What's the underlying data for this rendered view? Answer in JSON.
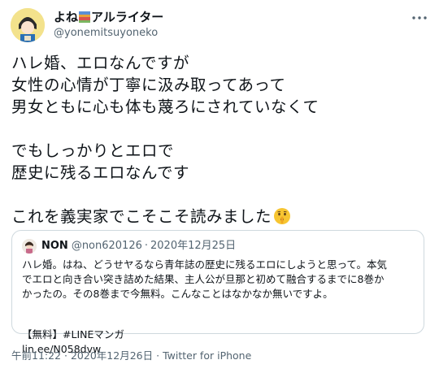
{
  "author": {
    "name_prefix": "よね",
    "name_suffix": "アルライター",
    "handle": "@yonemitsuyoneko"
  },
  "tweet": {
    "text": "ハレ婚、エロなんですが\n女性の心情が丁寧に汲み取ってあって\n男女ともに心も体も蔑ろにされていなくて\n\nでもしっかりとエロで\n歴史に残るエロなんです\n\nこれを義実家でこそこそ読みました",
    "emoji": "shushing-face-icon"
  },
  "quote": {
    "name": "NON",
    "handle": "@non620126",
    "separator": "·",
    "date": "2020年12月25日",
    "text": "ハレ婚。はね、どうせヤるなら青年誌の歴史に残るエロにしようと思って。本気\nでエロと向き合い突き詰めた結果、主人公が旦那と初めて融合するまでに8巻か\nかったの。その8巻まで今無料。こんなことはなかなか無いですよ。",
    "promo_prefix": "【無料】#LINEマンガ",
    "promo_link": "lin.ee/N058dvw"
  },
  "footer": {
    "time": "午前11:22",
    "separator": "·",
    "date": "2020年12月26日",
    "separator2": "·",
    "source": "Twitter for iPhone"
  },
  "colors": {
    "text": "#0f1419",
    "secondary": "#536471",
    "border": "#cfd9de"
  }
}
